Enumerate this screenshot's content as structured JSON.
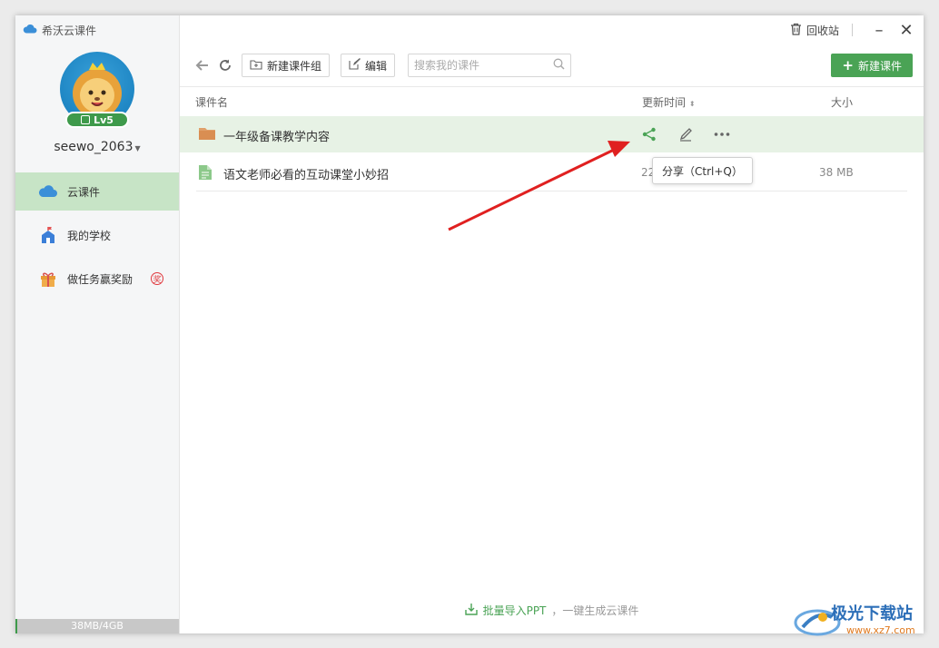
{
  "app": {
    "title": "希沃云课件"
  },
  "user": {
    "name": "seewo_2063",
    "level": "Lv5"
  },
  "sidebar": {
    "items": [
      {
        "label": "云课件",
        "icon": "cloud-icon",
        "active": true
      },
      {
        "label": "我的学校",
        "icon": "school-icon",
        "active": false
      },
      {
        "label": "做任务赢奖励",
        "icon": "gift-icon",
        "active": false,
        "badge": "奖"
      }
    ],
    "storage": {
      "label": "38MB/4GB",
      "used_fraction": 0.01
    }
  },
  "topbar": {
    "recycle_label": "回收站",
    "minimize": "–",
    "close": "✕"
  },
  "toolbar": {
    "new_group_label": "新建课件组",
    "edit_label": "编辑",
    "search_placeholder": "搜索我的课件",
    "new_courseware_label": "新建课件"
  },
  "table": {
    "columns": {
      "name": "课件名",
      "time": "更新时间",
      "size": "大小"
    },
    "rows": [
      {
        "type": "folder",
        "name": "一年级备课教学内容",
        "time": "",
        "size": ""
      },
      {
        "type": "file",
        "name": "语文老师必看的互动课堂小妙招",
        "time": "22",
        "size": "38 MB"
      }
    ]
  },
  "tooltip": {
    "text": "分享（Ctrl+Q）"
  },
  "footer": {
    "import_label": "批量导入PPT",
    "suffix": "，一键生成云课件"
  },
  "watermark": {
    "text": "极光下载站",
    "url": "www.xz7.com"
  },
  "colors": {
    "accent": "#4aa355",
    "highlight_row": "#e7f2e5",
    "active_nav": "#c7e4c6",
    "arrow": "#e02020"
  }
}
